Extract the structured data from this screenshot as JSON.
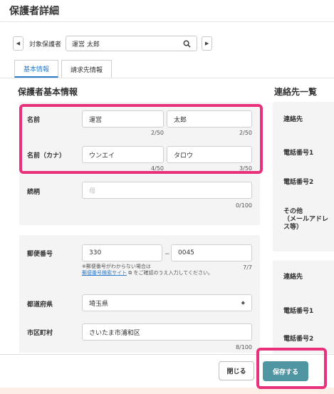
{
  "page": {
    "title": "保護者詳細"
  },
  "selector": {
    "label": "対象保護者",
    "value": "運営 太郎"
  },
  "tabs": [
    {
      "label": "基本情報",
      "active": true
    },
    {
      "label": "請求先情報",
      "active": false
    }
  ],
  "left_section": {
    "heading": "保護者基本情報"
  },
  "right_section": {
    "heading": "連絡先一覧"
  },
  "form": {
    "name": {
      "label": "名前",
      "last": "運営",
      "first": "太郎",
      "last_count": "2/50",
      "first_count": "2/50"
    },
    "name_kana": {
      "label": "名前（カナ）",
      "last": "ウンエイ",
      "first": "タロウ",
      "last_count": "4/50",
      "first_count": "3/50"
    },
    "relation": {
      "label": "続柄",
      "placeholder": "母",
      "count": "0/100"
    },
    "postal": {
      "label": "郵便番号",
      "part1": "330",
      "part2": "0045",
      "dash": "−",
      "count": "7/7",
      "hint_pre": "※郵便番号がわからない場合は",
      "hint_link": "郵便番号検索サイト",
      "hint_post": "をご確認のうえ入力してください。"
    },
    "prefecture": {
      "label": "都道府県",
      "value": "埼玉県"
    },
    "city": {
      "label": "市区町村",
      "value": "さいたま市浦和区",
      "count": "8/100"
    }
  },
  "contacts": {
    "group1": [
      "連絡先",
      "電話番号1",
      "電話番号2",
      "その他\n（メールアドレス等）"
    ],
    "group2": [
      "連絡先",
      "電話番号1",
      "電話番号2"
    ]
  },
  "buttons": {
    "close": "閉じる",
    "save": "保存する"
  },
  "colors": {
    "accent": "#2d7cc9",
    "save_button": "#4f96a2",
    "highlight": "#e8317a"
  }
}
